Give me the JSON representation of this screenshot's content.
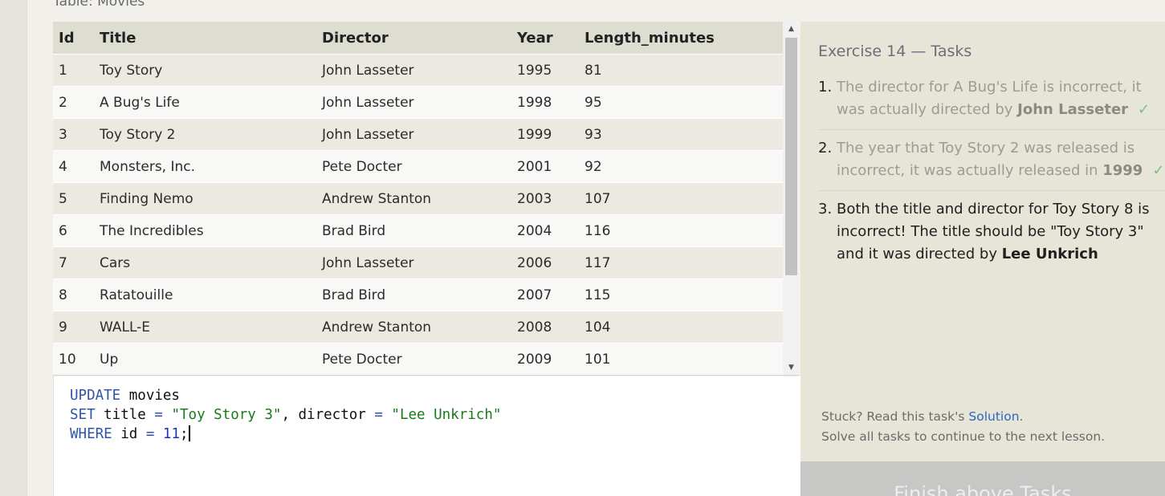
{
  "table": {
    "caption": "Table: Movies",
    "columns": [
      "Id",
      "Title",
      "Director",
      "Year",
      "Length_minutes"
    ],
    "rows": [
      [
        "1",
        "Toy Story",
        "John Lasseter",
        "1995",
        "81"
      ],
      [
        "2",
        "A Bug's Life",
        "John Lasseter",
        "1998",
        "95"
      ],
      [
        "3",
        "Toy Story 2",
        "John Lasseter",
        "1999",
        "93"
      ],
      [
        "4",
        "Monsters, Inc.",
        "Pete Docter",
        "2001",
        "92"
      ],
      [
        "5",
        "Finding Nemo",
        "Andrew Stanton",
        "2003",
        "107"
      ],
      [
        "6",
        "The Incredibles",
        "Brad Bird",
        "2004",
        "116"
      ],
      [
        "7",
        "Cars",
        "John Lasseter",
        "2006",
        "117"
      ],
      [
        "8",
        "Ratatouille",
        "Brad Bird",
        "2007",
        "115"
      ],
      [
        "9",
        "WALL-E",
        "Andrew Stanton",
        "2008",
        "104"
      ],
      [
        "10",
        "Up",
        "Pete Docter",
        "2009",
        "101"
      ]
    ]
  },
  "editor": {
    "line1": {
      "kw": "UPDATE",
      "rest": " movies"
    },
    "line2": {
      "kw": "SET",
      "a": " title ",
      "eq1": "=",
      "s1": " \"Toy Story 3\"",
      "b": ", director ",
      "eq2": "=",
      "s2": " \"Lee Unkrich\""
    },
    "line3": {
      "kw": "WHERE",
      "a": " id ",
      "eq": "=",
      "num": " 11",
      "end": ";"
    }
  },
  "panel": {
    "title": "Exercise 14 — Tasks",
    "tasks": [
      {
        "num": "1.",
        "text": "The director for A Bug's Life is incorrect, it was actually directed by ",
        "bold": "John Lasseter",
        "check": "✓"
      },
      {
        "num": "2.",
        "text": "The year that Toy Story 2 was released is incorrect, it was actually released in ",
        "bold": "1999",
        "check": "✓"
      },
      {
        "num": "3.",
        "text": "Both the title and director for Toy Story 8 is incorrect! The title should be \"Toy Story 3\" and it was directed by ",
        "bold": "Lee Unkrich"
      }
    ],
    "help_prefix": "Stuck? Read this task's ",
    "help_link": "Solution",
    "help_suffix": ".",
    "help_line2": "Solve all tasks to continue to the next lesson."
  },
  "finish_button": {
    "label": "Finish above Tasks"
  },
  "scrollbar": {
    "up_glyph": "▲",
    "down_glyph": "▼"
  },
  "colors": {
    "keyword": "#3054a8",
    "string": "#1a7a1a",
    "check": "#79c07a",
    "link": "#2f63c7"
  }
}
